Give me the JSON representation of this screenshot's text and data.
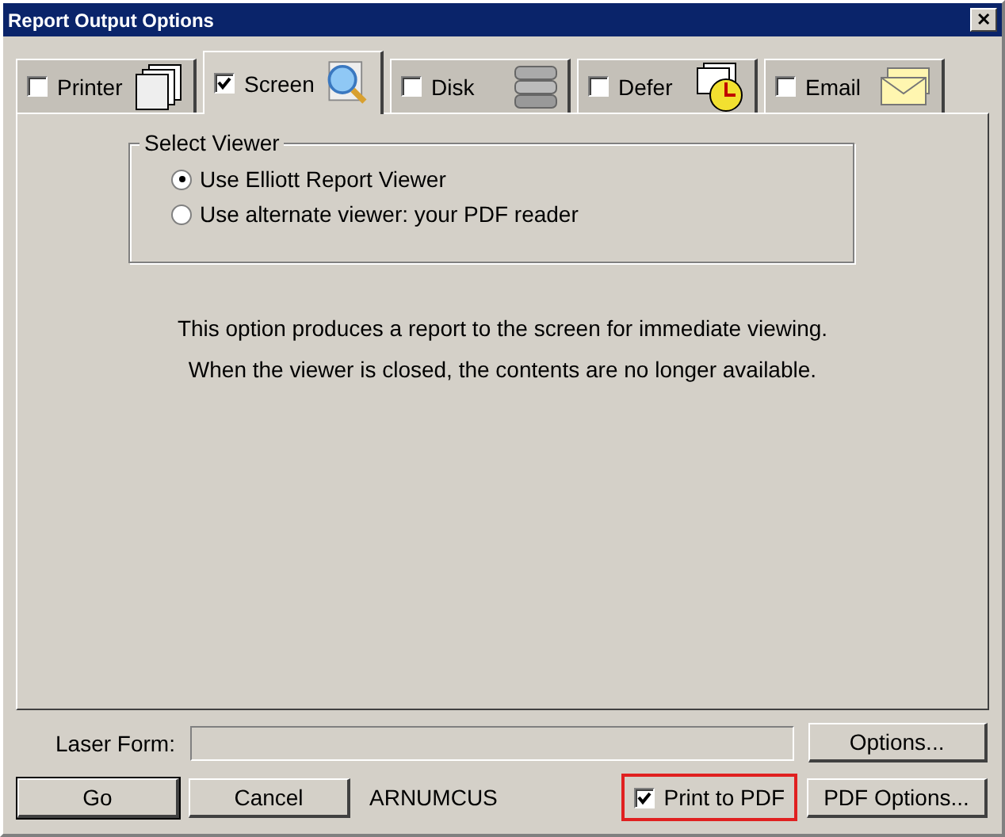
{
  "window": {
    "title": "Report Output Options",
    "close": "✕"
  },
  "tabs": [
    {
      "label": "Printer",
      "checked": false,
      "selected": false,
      "kind": "pages"
    },
    {
      "label": "Screen",
      "checked": true,
      "selected": true,
      "kind": "magnifier"
    },
    {
      "label": "Disk",
      "checked": false,
      "selected": false,
      "kind": "disk"
    },
    {
      "label": "Defer",
      "checked": false,
      "selected": false,
      "kind": "clock"
    },
    {
      "label": "Email",
      "checked": false,
      "selected": false,
      "kind": "envelope"
    }
  ],
  "viewer_group": {
    "title": "Select Viewer",
    "options": [
      {
        "label": "Use Elliott Report Viewer",
        "selected": true
      },
      {
        "label": "Use alternate viewer: your PDF reader",
        "selected": false
      }
    ]
  },
  "description": [
    "This option produces a report to the screen for immediate viewing.",
    "When the viewer is closed, the contents are no longer available."
  ],
  "laser_form": {
    "label": "Laser Form:",
    "button": "Options..."
  },
  "footer": {
    "go": "Go",
    "cancel": "Cancel",
    "report_code": "ARNUMCUS",
    "print_to_pdf": {
      "label": "Print to PDF",
      "checked": true
    },
    "pdf_options": "PDF Options..."
  }
}
